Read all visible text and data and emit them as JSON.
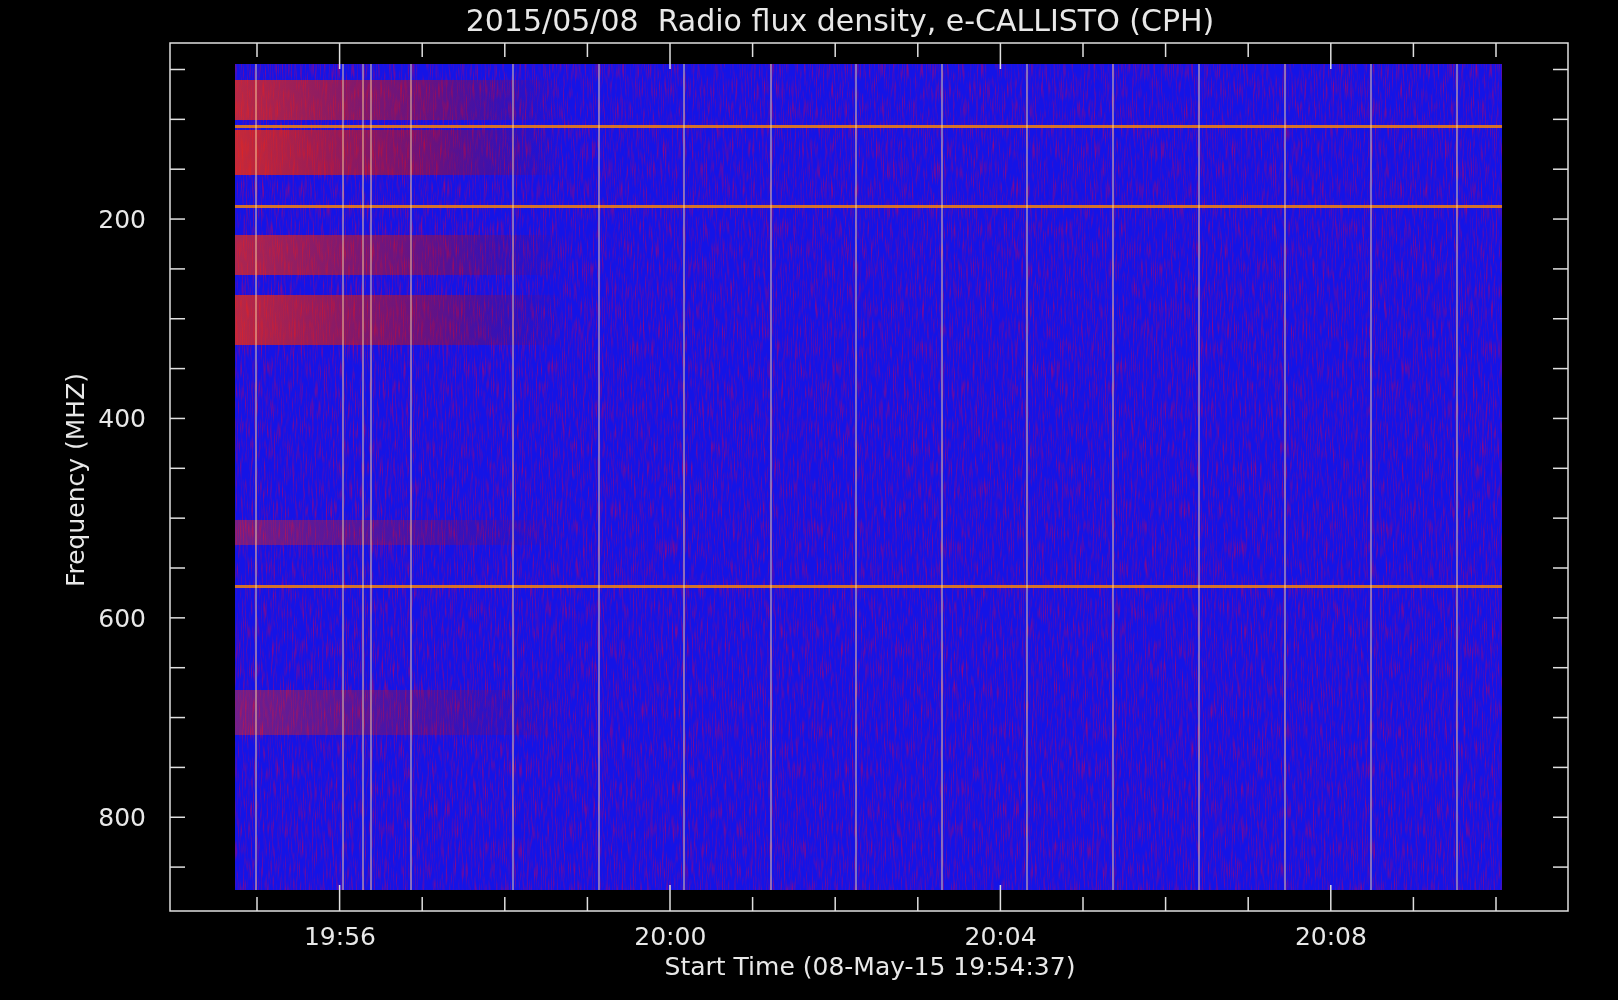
{
  "title": "2015/05/08  Radio flux density, e-CALLISTO (CPH)",
  "y_axis": {
    "label": "Frequency (MHZ)",
    "ticks": [
      "200",
      "400",
      "600",
      "800"
    ]
  },
  "x_axis": {
    "label": "Start Time (08-May-15 19:54:37)",
    "ticks": [
      "19:56",
      "20:00",
      "20:04",
      "20:08"
    ]
  }
}
